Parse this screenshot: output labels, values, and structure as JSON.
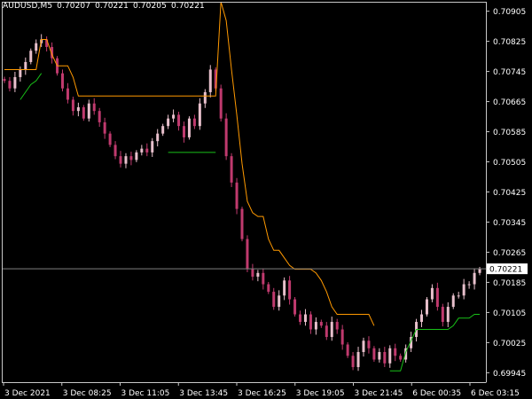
{
  "chart_window": {
    "symbol_timeframe": "AUDUSD,M5",
    "bar_ohlc": [
      "0.70207",
      "0.70221",
      "0.70205",
      "0.70221"
    ],
    "current_price_label": "0.70221",
    "colors": {
      "background": "#000000",
      "axis": "#c8c8c8",
      "candle_up": "#e8c0cc",
      "candle_down": "#c03a6e",
      "upper_band": "#ff9900",
      "lower_band": "#18c018",
      "current_price_line": "#808080"
    }
  },
  "chart_data": {
    "type": "candlestick",
    "timeframe": "M5",
    "title": "AUDUSD,M5",
    "y_ticks": [
      "0.70905",
      "0.70825",
      "0.70745",
      "0.70665",
      "0.70585",
      "0.70505",
      "0.70425",
      "0.70345",
      "0.70265",
      "0.70185",
      "0.70105",
      "0.70025",
      "0.69945"
    ],
    "x_ticks": [
      "3 Dec 2021",
      "3 Dec 08:25",
      "3 Dec 11:05",
      "3 Dec 13:45",
      "3 Dec 16:25",
      "3 Dec 19:05",
      "3 Dec 21:45",
      "6 Dec 00:35",
      "6 Dec 03:15"
    ],
    "ylim": [
      0.6992,
      0.7093
    ],
    "current_price": 0.70221,
    "series": [
      {
        "name": "close",
        "values": [
          0.7072,
          0.707,
          0.7073,
          0.7075,
          0.7077,
          0.708,
          0.7082,
          0.7083,
          0.7081,
          0.7078,
          0.7074,
          0.707,
          0.7067,
          0.7064,
          0.7065,
          0.7062,
          0.7066,
          0.7064,
          0.7061,
          0.7058,
          0.7055,
          0.7052,
          0.705,
          0.7052,
          0.7051,
          0.7053,
          0.7054,
          0.7053,
          0.7056,
          0.7058,
          0.706,
          0.7062,
          0.7063,
          0.706,
          0.7057,
          0.7062,
          0.706,
          0.7066,
          0.7069,
          0.7075,
          0.707,
          0.7062,
          0.7052,
          0.7045,
          0.7038,
          0.703,
          0.7022,
          0.702,
          0.7021,
          0.7018,
          0.7016,
          0.7012,
          0.7015,
          0.7019,
          0.7014,
          0.701,
          0.7008,
          0.701,
          0.7006,
          0.7008,
          0.7007,
          0.7004,
          0.7008,
          0.7006,
          0.7002,
          0.6999,
          0.6996,
          0.7,
          0.7003,
          0.7001,
          0.6998,
          0.7,
          0.6997,
          0.7001,
          0.6999,
          0.6998,
          0.7001,
          0.7004,
          0.7008,
          0.701,
          0.7014,
          0.7017,
          0.7012,
          0.7008,
          0.7012,
          0.7015,
          0.7015,
          0.7018,
          0.7018,
          0.7021,
          0.7022
        ]
      },
      {
        "name": "upper_band",
        "values": [
          0.7075,
          0.7075,
          0.7075,
          0.7075,
          0.7075,
          0.7075,
          0.7075,
          0.7083,
          0.7083,
          0.7079,
          0.7076,
          0.7076,
          0.7076,
          0.7073,
          0.7068,
          0.7068,
          0.7068,
          0.7068,
          0.7068,
          0.7068,
          0.7068,
          0.7068,
          0.7068,
          0.7068,
          0.7068,
          0.7068,
          0.7068,
          0.7068,
          0.7068,
          0.7068,
          0.7068,
          0.7068,
          0.7068,
          0.7068,
          0.7068,
          0.7068,
          0.7068,
          0.7068,
          0.7068,
          0.7068,
          0.7068,
          0.7093,
          0.7088,
          0.7075,
          0.7063,
          0.705,
          0.704,
          0.7037,
          0.7036,
          0.7036,
          0.703,
          0.7027,
          0.7027,
          0.7025,
          0.7023,
          0.7022,
          0.7022,
          0.7022,
          0.7022,
          0.7021,
          0.7019,
          0.7016,
          0.7012,
          0.701,
          0.701,
          0.701,
          0.701,
          0.701,
          0.701,
          0.701,
          0.7007,
          null,
          null,
          null,
          null,
          null,
          null,
          null,
          null,
          null,
          null,
          null,
          null,
          null,
          null,
          null,
          null,
          null,
          null,
          null,
          null
        ]
      },
      {
        "name": "lower_band",
        "values": [
          null,
          null,
          null,
          0.7067,
          0.7069,
          0.7071,
          0.7072,
          0.7074,
          null,
          null,
          null,
          null,
          null,
          null,
          null,
          null,
          null,
          null,
          null,
          null,
          null,
          null,
          null,
          null,
          null,
          null,
          null,
          null,
          null,
          null,
          null,
          0.7053,
          0.7053,
          0.7053,
          0.7053,
          0.7053,
          0.7053,
          0.7053,
          0.7053,
          0.7053,
          0.7053,
          null,
          null,
          null,
          null,
          null,
          null,
          null,
          null,
          null,
          null,
          null,
          null,
          null,
          null,
          null,
          null,
          null,
          null,
          null,
          null,
          null,
          null,
          null,
          null,
          null,
          null,
          null,
          null,
          null,
          null,
          null,
          null,
          0.6995,
          0.6995,
          0.6995,
          0.7,
          0.7003,
          0.7006,
          0.7006,
          0.7006,
          0.7006,
          0.7006,
          0.7006,
          0.7006,
          0.7007,
          0.7009,
          0.7009,
          0.7009,
          0.701,
          0.701
        ]
      }
    ],
    "grid": false
  }
}
